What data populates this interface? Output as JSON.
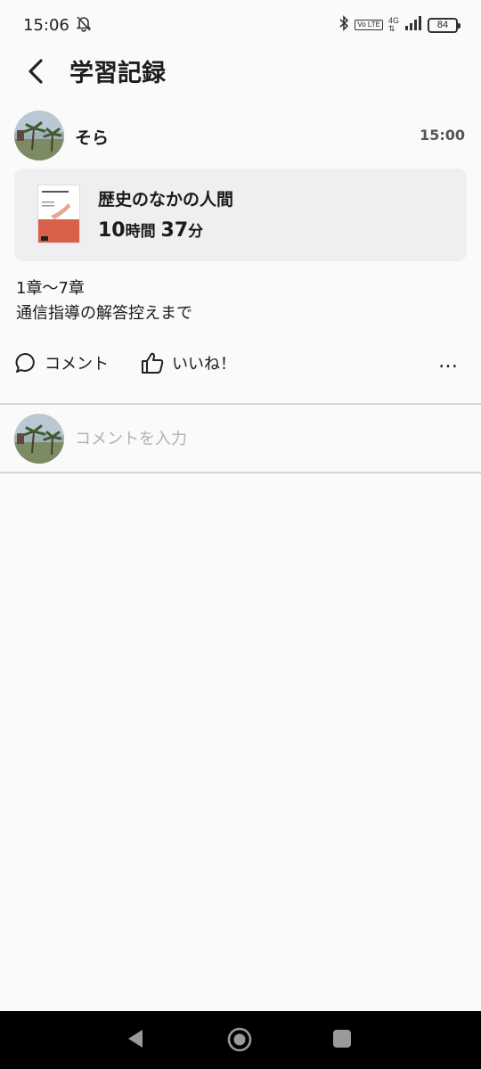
{
  "status_bar": {
    "time": "15:06",
    "network": "4G",
    "volte": "Vo LTE",
    "battery": "84"
  },
  "header": {
    "title": "学習記録"
  },
  "post": {
    "user_name": "そら",
    "time": "15:00",
    "book": {
      "title": "歴史のなかの人間",
      "hours": "10",
      "hours_unit": "時間",
      "minutes": "37",
      "minutes_unit": "分"
    },
    "body_line1": "1章〜7章",
    "body_line2": "通信指導の解答控えまで",
    "actions": {
      "comment_label": "コメント",
      "like_label": "いいね！",
      "more_label": "…"
    }
  },
  "comment_box": {
    "placeholder": "コメントを入力"
  },
  "colors": {
    "background": "#fafafa",
    "card": "#efeff1",
    "cover_accent": "#d9604a",
    "divider": "#d6d6d6"
  }
}
